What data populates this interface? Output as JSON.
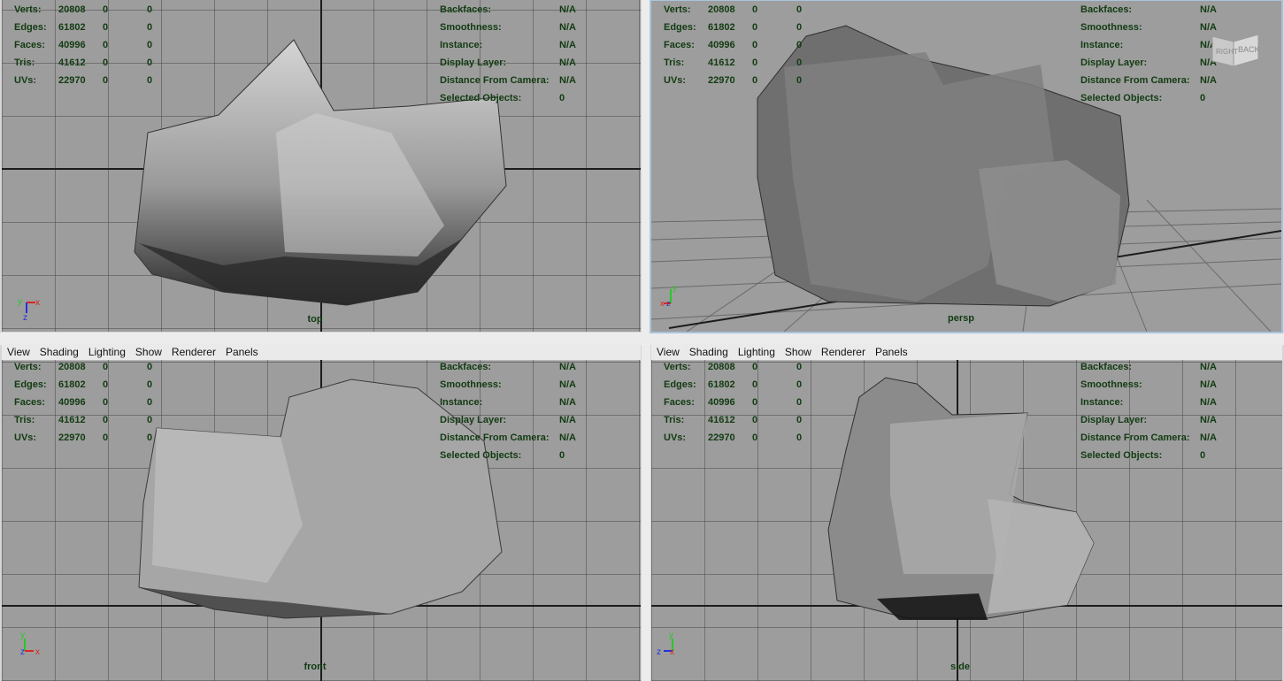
{
  "menu": [
    "View",
    "Shading",
    "Lighting",
    "Show",
    "Renderer",
    "Panels"
  ],
  "hud_left": [
    {
      "label": "Verts:",
      "v1": "20808",
      "v2": "0",
      "v3": "0"
    },
    {
      "label": "Edges:",
      "v1": "61802",
      "v2": "0",
      "v3": "0"
    },
    {
      "label": "Faces:",
      "v1": "40996",
      "v2": "0",
      "v3": "0"
    },
    {
      "label": "Tris:",
      "v1": "41612",
      "v2": "0",
      "v3": "0"
    },
    {
      "label": "UVs:",
      "v1": "22970",
      "v2": "0",
      "v3": "0"
    }
  ],
  "hud_right": [
    {
      "label": "Backfaces:",
      "value": "N/A"
    },
    {
      "label": "Smoothness:",
      "value": "N/A"
    },
    {
      "label": "Instance:",
      "value": "N/A"
    },
    {
      "label": "Display Layer:",
      "value": "N/A"
    },
    {
      "label": "Distance From Camera:",
      "value": "N/A"
    },
    {
      "label": "Selected Objects:",
      "value": "0"
    }
  ],
  "viewports": [
    {
      "camera": "top",
      "active": false
    },
    {
      "camera": "persp",
      "active": true
    },
    {
      "camera": "front",
      "active": false
    },
    {
      "camera": "side",
      "active": false
    }
  ],
  "viewcube": {
    "left": "RIGHT",
    "right": "BACK"
  },
  "axes": {
    "x": "x",
    "y": "y",
    "z": "z"
  },
  "colors": {
    "viewport_bg": "#9d9d9d",
    "hud_text": "#123b12",
    "x_axis": "#d9281e",
    "y_axis": "#28c828",
    "z_axis": "#2432d8"
  }
}
